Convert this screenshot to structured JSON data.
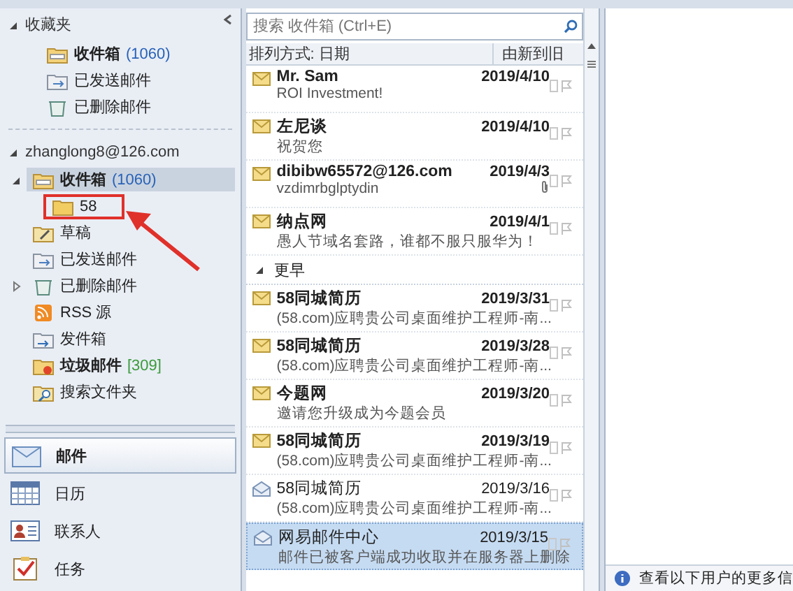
{
  "favorites": {
    "label": "收藏夹",
    "expanded": true,
    "items": [
      {
        "kind": "inbox",
        "name": "收件箱",
        "count": "(1060)",
        "selected": false
      },
      {
        "kind": "sent",
        "name": "已发送邮件",
        "selected": false
      },
      {
        "kind": "deleted",
        "name": "已删除邮件",
        "selected": false
      }
    ]
  },
  "account": {
    "label": "zhanglong8@126.com",
    "expanded": true,
    "folders": [
      {
        "kind": "inbox",
        "name": "收件箱",
        "count": "(1060)",
        "selected": true,
        "expanded": true,
        "children": [
          {
            "kind": "folder",
            "name": "58",
            "selected": false,
            "annotated": true
          }
        ]
      },
      {
        "kind": "drafts",
        "name": "草稿",
        "selected": false
      },
      {
        "kind": "sent",
        "name": "已发送邮件",
        "selected": false
      },
      {
        "kind": "deleted",
        "name": "已删除邮件",
        "selected": false,
        "expanded": false
      },
      {
        "kind": "rss",
        "name": "RSS 源",
        "selected": false
      },
      {
        "kind": "outbox",
        "name": "发件箱",
        "selected": false
      },
      {
        "kind": "junk",
        "name": "垃圾邮件",
        "count": "[309]",
        "selected": false
      },
      {
        "kind": "search",
        "name": "搜索文件夹",
        "selected": false
      }
    ]
  },
  "modules": [
    {
      "kind": "mail",
      "label": "邮件",
      "selected": true
    },
    {
      "kind": "calendar",
      "label": "日历",
      "selected": false
    },
    {
      "kind": "contacts",
      "label": "联系人",
      "selected": false
    },
    {
      "kind": "tasks",
      "label": "任务",
      "selected": false
    }
  ],
  "mail_list": {
    "search": {
      "placeholder": "搜索 收件箱 (Ctrl+E)"
    },
    "sort": {
      "label": "排列方式: 日期",
      "order": "由新到旧"
    },
    "groups": [
      {
        "messages": [
          {
            "sender": "Mr. Sam",
            "date": "2019/4/10",
            "preview": "ROI Investment!",
            "read": false,
            "attachment": false,
            "selected": false
          },
          {
            "sender": "左尼谈",
            "date": "2019/4/10",
            "preview": "祝贺您",
            "read": false,
            "attachment": false,
            "selected": false
          },
          {
            "sender": "dibibw65572@126.com",
            "date": "2019/4/3",
            "preview": "vzdimrbglptydin",
            "read": false,
            "attachment": true,
            "selected": false
          },
          {
            "sender": "纳点网",
            "date": "2019/4/1",
            "preview": "愚人节域名套路，谁都不服只服华为！",
            "read": false,
            "attachment": false,
            "selected": false
          }
        ]
      },
      {
        "label": "更早",
        "expanded": true,
        "messages": [
          {
            "sender": "58同城简历",
            "date": "2019/3/31",
            "preview": "(58.com)应聘贵公司桌面维护工程师-南...",
            "read": false,
            "attachment": false,
            "selected": false
          },
          {
            "sender": "58同城简历",
            "date": "2019/3/28",
            "preview": "(58.com)应聘贵公司桌面维护工程师-南...",
            "read": false,
            "attachment": false,
            "selected": false
          },
          {
            "sender": "今题网",
            "date": "2019/3/20",
            "preview": "邀请您升级成为今题会员",
            "read": false,
            "attachment": false,
            "selected": false
          },
          {
            "sender": "58同城简历",
            "date": "2019/3/19",
            "preview": "(58.com)应聘贵公司桌面维护工程师-南...",
            "read": false,
            "attachment": false,
            "selected": false
          },
          {
            "sender": "58同城简历",
            "date": "2019/3/16",
            "preview": "(58.com)应聘贵公司桌面维护工程师-南...",
            "read": true,
            "attachment": false,
            "selected": false
          },
          {
            "sender": "网易邮件中心",
            "date": "2019/3/15",
            "preview": "邮件已被客户端成功收取并在服务器上删除",
            "read": true,
            "attachment": false,
            "selected": true
          }
        ]
      }
    ]
  },
  "reading_pane": {
    "info_bar": {
      "text": "查看以下用户的更多信"
    }
  }
}
